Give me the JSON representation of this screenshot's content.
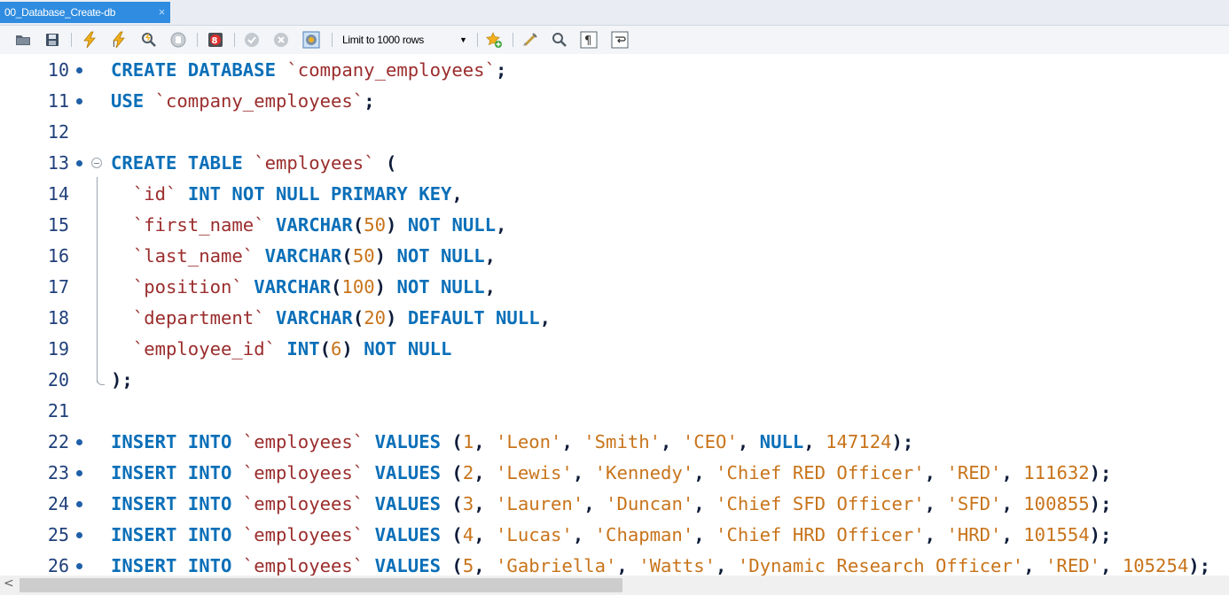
{
  "tab": {
    "title": "00_Database_Create-db",
    "close_glyph": "×"
  },
  "toolbar": {
    "buttons": [
      "open-sql-file-icon",
      "save-file-icon",
      "execute-all-icon",
      "execute-selection-icon",
      "explain-icon",
      "stop-icon",
      "toggle-error-stop-icon",
      "commit-icon",
      "rollback-icon",
      "auto-commit-icon",
      "add-snippet-icon",
      "beautify-icon",
      "find-icon",
      "invisible-chars-icon",
      "word-wrap-icon"
    ],
    "limit_select": {
      "value": "Limit to 1000 rows",
      "caret": "▼"
    }
  },
  "editor": {
    "lines": [
      {
        "n": "10",
        "bullet": true,
        "fold": "",
        "tokens": [
          [
            "kw",
            "CREATE DATABASE"
          ],
          [
            "t",
            " "
          ],
          [
            "id",
            "`company_employees`"
          ],
          [
            "pn",
            ";"
          ]
        ]
      },
      {
        "n": "11",
        "bullet": true,
        "fold": "",
        "tokens": [
          [
            "kw",
            "USE"
          ],
          [
            "t",
            " "
          ],
          [
            "id",
            "`company_employees`"
          ],
          [
            "pn",
            ";"
          ]
        ]
      },
      {
        "n": "12",
        "bullet": false,
        "fold": "",
        "tokens": []
      },
      {
        "n": "13",
        "bullet": true,
        "fold": "start",
        "tokens": [
          [
            "kw",
            "CREATE TABLE"
          ],
          [
            "t",
            " "
          ],
          [
            "id",
            "`employees`"
          ],
          [
            "t",
            " "
          ],
          [
            "pn",
            "("
          ]
        ]
      },
      {
        "n": "14",
        "bullet": false,
        "fold": "",
        "tokens": [
          [
            "t",
            "  "
          ],
          [
            "id",
            "`id`"
          ],
          [
            "t",
            " "
          ],
          [
            "kw",
            "INT NOT NULL PRIMARY KEY"
          ],
          [
            "pn",
            ","
          ]
        ]
      },
      {
        "n": "15",
        "bullet": false,
        "fold": "",
        "tokens": [
          [
            "t",
            "  "
          ],
          [
            "id",
            "`first_name`"
          ],
          [
            "t",
            " "
          ],
          [
            "kw",
            "VARCHAR"
          ],
          [
            "pn",
            "("
          ],
          [
            "num",
            "50"
          ],
          [
            "pn",
            ")"
          ],
          [
            "t",
            " "
          ],
          [
            "kw",
            "NOT NULL"
          ],
          [
            "pn",
            ","
          ]
        ]
      },
      {
        "n": "16",
        "bullet": false,
        "fold": "",
        "tokens": [
          [
            "t",
            "  "
          ],
          [
            "id",
            "`last_name`"
          ],
          [
            "t",
            " "
          ],
          [
            "kw",
            "VARCHAR"
          ],
          [
            "pn",
            "("
          ],
          [
            "num",
            "50"
          ],
          [
            "pn",
            ")"
          ],
          [
            "t",
            " "
          ],
          [
            "kw",
            "NOT NULL"
          ],
          [
            "pn",
            ","
          ]
        ]
      },
      {
        "n": "17",
        "bullet": false,
        "fold": "",
        "tokens": [
          [
            "t",
            "  "
          ],
          [
            "id",
            "`position`"
          ],
          [
            "t",
            " "
          ],
          [
            "kw",
            "VARCHAR"
          ],
          [
            "pn",
            "("
          ],
          [
            "num",
            "100"
          ],
          [
            "pn",
            ")"
          ],
          [
            "t",
            " "
          ],
          [
            "kw",
            "NOT NULL"
          ],
          [
            "pn",
            ","
          ]
        ]
      },
      {
        "n": "18",
        "bullet": false,
        "fold": "",
        "tokens": [
          [
            "t",
            "  "
          ],
          [
            "id",
            "`department`"
          ],
          [
            "t",
            " "
          ],
          [
            "kw",
            "VARCHAR"
          ],
          [
            "pn",
            "("
          ],
          [
            "num",
            "20"
          ],
          [
            "pn",
            ")"
          ],
          [
            "t",
            " "
          ],
          [
            "kw",
            "DEFAULT NULL"
          ],
          [
            "pn",
            ","
          ]
        ]
      },
      {
        "n": "19",
        "bullet": false,
        "fold": "",
        "tokens": [
          [
            "t",
            "  "
          ],
          [
            "id",
            "`employee_id`"
          ],
          [
            "t",
            " "
          ],
          [
            "kw",
            "INT"
          ],
          [
            "pn",
            "("
          ],
          [
            "num",
            "6"
          ],
          [
            "pn",
            ")"
          ],
          [
            "t",
            " "
          ],
          [
            "kw",
            "NOT NULL"
          ]
        ]
      },
      {
        "n": "20",
        "bullet": false,
        "fold": "end",
        "tokens": [
          [
            "pn",
            ");"
          ]
        ]
      },
      {
        "n": "21",
        "bullet": false,
        "fold": "",
        "tokens": []
      },
      {
        "n": "22",
        "bullet": true,
        "fold": "",
        "tokens": [
          [
            "kw",
            "INSERT INTO"
          ],
          [
            "t",
            " "
          ],
          [
            "id",
            "`employees`"
          ],
          [
            "t",
            " "
          ],
          [
            "kw",
            "VALUES"
          ],
          [
            "t",
            " "
          ],
          [
            "pn",
            "("
          ],
          [
            "num",
            "1"
          ],
          [
            "pn",
            ","
          ],
          [
            "t",
            " "
          ],
          [
            "str",
            "'Leon'"
          ],
          [
            "pn",
            ","
          ],
          [
            "t",
            " "
          ],
          [
            "str",
            "'Smith'"
          ],
          [
            "pn",
            ","
          ],
          [
            "t",
            " "
          ],
          [
            "str",
            "'CEO'"
          ],
          [
            "pn",
            ","
          ],
          [
            "t",
            " "
          ],
          [
            "kw",
            "NULL"
          ],
          [
            "pn",
            ","
          ],
          [
            "t",
            " "
          ],
          [
            "num",
            "147124"
          ],
          [
            "pn",
            ");"
          ]
        ]
      },
      {
        "n": "23",
        "bullet": true,
        "fold": "",
        "tokens": [
          [
            "kw",
            "INSERT INTO"
          ],
          [
            "t",
            " "
          ],
          [
            "id",
            "`employees`"
          ],
          [
            "t",
            " "
          ],
          [
            "kw",
            "VALUES"
          ],
          [
            "t",
            " "
          ],
          [
            "pn",
            "("
          ],
          [
            "num",
            "2"
          ],
          [
            "pn",
            ","
          ],
          [
            "t",
            " "
          ],
          [
            "str",
            "'Lewis'"
          ],
          [
            "pn",
            ","
          ],
          [
            "t",
            " "
          ],
          [
            "str",
            "'Kennedy'"
          ],
          [
            "pn",
            ","
          ],
          [
            "t",
            " "
          ],
          [
            "str",
            "'Chief RED Officer'"
          ],
          [
            "pn",
            ","
          ],
          [
            "t",
            " "
          ],
          [
            "str",
            "'RED'"
          ],
          [
            "pn",
            ","
          ],
          [
            "t",
            " "
          ],
          [
            "num",
            "111632"
          ],
          [
            "pn",
            ");"
          ]
        ]
      },
      {
        "n": "24",
        "bullet": true,
        "fold": "",
        "tokens": [
          [
            "kw",
            "INSERT INTO"
          ],
          [
            "t",
            " "
          ],
          [
            "id",
            "`employees`"
          ],
          [
            "t",
            " "
          ],
          [
            "kw",
            "VALUES"
          ],
          [
            "t",
            " "
          ],
          [
            "pn",
            "("
          ],
          [
            "num",
            "3"
          ],
          [
            "pn",
            ","
          ],
          [
            "t",
            " "
          ],
          [
            "str",
            "'Lauren'"
          ],
          [
            "pn",
            ","
          ],
          [
            "t",
            " "
          ],
          [
            "str",
            "'Duncan'"
          ],
          [
            "pn",
            ","
          ],
          [
            "t",
            " "
          ],
          [
            "str",
            "'Chief SFD Officer'"
          ],
          [
            "pn",
            ","
          ],
          [
            "t",
            " "
          ],
          [
            "str",
            "'SFD'"
          ],
          [
            "pn",
            ","
          ],
          [
            "t",
            " "
          ],
          [
            "num",
            "100855"
          ],
          [
            "pn",
            ");"
          ]
        ]
      },
      {
        "n": "25",
        "bullet": true,
        "fold": "",
        "tokens": [
          [
            "kw",
            "INSERT INTO"
          ],
          [
            "t",
            " "
          ],
          [
            "id",
            "`employees`"
          ],
          [
            "t",
            " "
          ],
          [
            "kw",
            "VALUES"
          ],
          [
            "t",
            " "
          ],
          [
            "pn",
            "("
          ],
          [
            "num",
            "4"
          ],
          [
            "pn",
            ","
          ],
          [
            "t",
            " "
          ],
          [
            "str",
            "'Lucas'"
          ],
          [
            "pn",
            ","
          ],
          [
            "t",
            " "
          ],
          [
            "str",
            "'Chapman'"
          ],
          [
            "pn",
            ","
          ],
          [
            "t",
            " "
          ],
          [
            "str",
            "'Chief HRD Officer'"
          ],
          [
            "pn",
            ","
          ],
          [
            "t",
            " "
          ],
          [
            "str",
            "'HRD'"
          ],
          [
            "pn",
            ","
          ],
          [
            "t",
            " "
          ],
          [
            "num",
            "101554"
          ],
          [
            "pn",
            ");"
          ]
        ]
      },
      {
        "n": "26",
        "bullet": true,
        "fold": "",
        "tokens": [
          [
            "kw",
            "INSERT INTO"
          ],
          [
            "t",
            " "
          ],
          [
            "id",
            "`employees`"
          ],
          [
            "t",
            " "
          ],
          [
            "kw",
            "VALUES"
          ],
          [
            "t",
            " "
          ],
          [
            "pn",
            "("
          ],
          [
            "num",
            "5"
          ],
          [
            "pn",
            ","
          ],
          [
            "t",
            " "
          ],
          [
            "str",
            "'Gabriella'"
          ],
          [
            "pn",
            ","
          ],
          [
            "t",
            " "
          ],
          [
            "str",
            "'Watts'"
          ],
          [
            "pn",
            ","
          ],
          [
            "t",
            " "
          ],
          [
            "str",
            "'Dynamic Research Officer'"
          ],
          [
            "pn",
            ","
          ],
          [
            "t",
            " "
          ],
          [
            "str",
            "'RED'"
          ],
          [
            "pn",
            ","
          ],
          [
            "t",
            " "
          ],
          [
            "num",
            "105254"
          ],
          [
            "pn",
            ");"
          ]
        ]
      }
    ]
  },
  "scrollbar": {
    "left_arrow": "<",
    "thumb_fraction": 0.5
  },
  "colors": {
    "tab_active": "#2f8ce0",
    "keyword": "#0b6fb8",
    "identifier": "#9b2d2d",
    "string": "#c8741b",
    "number": "#c8741b",
    "line_number": "#1f3f7a"
  }
}
